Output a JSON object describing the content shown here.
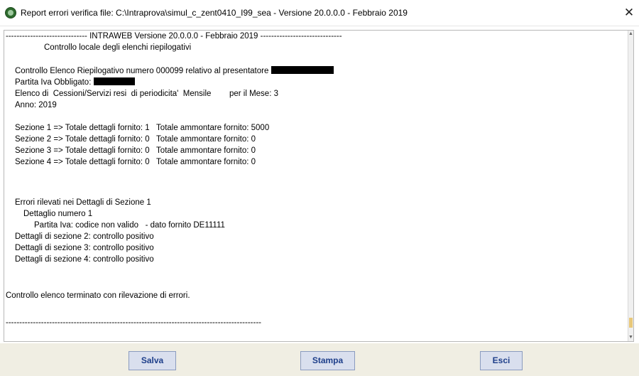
{
  "window": {
    "title": "Report errori verifica file: C:\\Intraprova\\simul_c_zent0410_I99_sea - Versione 20.0.0.0 - Febbraio 2019",
    "close_symbol": "✕",
    "app_icon": "globe-icon"
  },
  "report": {
    "header": "------------------------------ INTRAWEB Versione 20.0.0.0 - Febbraio 2019 ------------------------------",
    "subheader": "Controllo locale degli elenchi riepilogativi",
    "elenco_line": "Controllo Elenco Riepilogativo numero 000099 relativo al presentatore",
    "partita_iva_line": "Partita Iva Obbligato:",
    "elenco_tipo_line": "Elenco di  Cessioni/Servizi resi  di periodicita'  Mensile        per il Mese: 3",
    "anno_line": "Anno: 2019",
    "sezioni": [
      "Sezione 1 => Totale dettagli fornito: 1   Totale ammontare fornito: 5000",
      "Sezione 2 => Totale dettagli fornito: 0   Totale ammontare fornito: 0",
      "Sezione 3 => Totale dettagli fornito: 0   Totale ammontare fornito: 0",
      "Sezione 4 => Totale dettagli fornito: 0   Totale ammontare fornito: 0"
    ],
    "errori_title": "Errori rilevati nei Dettagli di Sezione 1",
    "dettaglio_numero": "Dettaglio numero 1",
    "errore_dettaglio": "Partita Iva: codice non valido   - dato fornito DE11111",
    "controlli": [
      "Dettagli di sezione 2: controllo positivo",
      "Dettagli di sezione 3: controllo positivo",
      "Dettagli di sezione 4: controllo positivo"
    ],
    "esito": "Controllo elenco terminato con rilevazione di errori.",
    "footer_rule": "----------------------------------------------------------------------------------------------"
  },
  "buttons": {
    "save": "Salva",
    "print": "Stampa",
    "exit": "Esci"
  },
  "colors": {
    "button_bg": "#d9dfee",
    "button_text": "#1e3f8a",
    "bottom_bar": "#f0eee3"
  }
}
